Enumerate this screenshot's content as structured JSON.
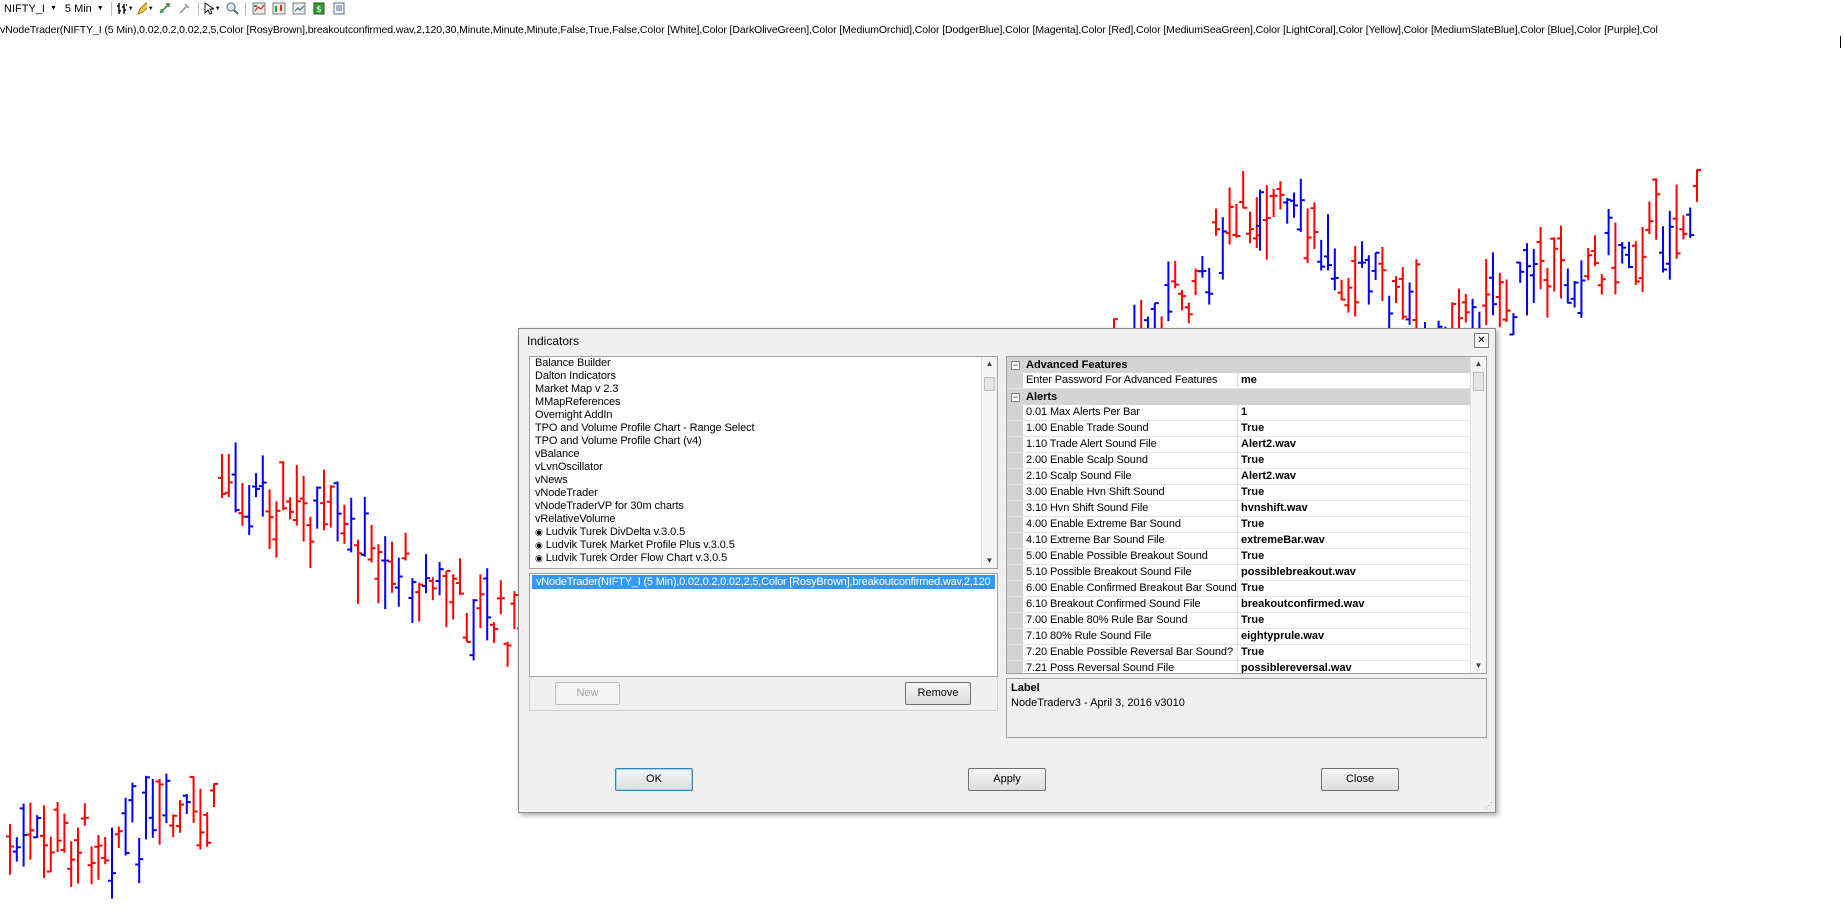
{
  "toolbar": {
    "instrument": "NIFTY_I",
    "interval": "5 Min"
  },
  "indicator_label": "vNodeTrader(NIFTY_I (5 Min),0.02,0.2,0.02,2,5,Color [RosyBrown],breakoutconfirmed.wav,2,120,30,Minute,Minute,Minute,False,True,False,Color [White],Color [DarkOliveGreen],Color [MediumOrchid],Color [DodgerBlue],Color [Magenta],Color [Red],Color [MediumSeaGreen],Color [LightCoral],Color [Yellow],Color [MediumSlateBlue],Color [Blue],Color [Purple],Col",
  "colors": {
    "up_bar": "#0000ff",
    "down_bar": "#ff0000",
    "selection": "#3399ff",
    "category_bg": "#d4d4d4"
  },
  "dialog": {
    "title": "Indicators",
    "indicators": [
      {
        "label": "Balance Builder",
        "icon": ""
      },
      {
        "label": "Dalton Indicators",
        "icon": ""
      },
      {
        "label": "Market Map v 2.3",
        "icon": ""
      },
      {
        "label": "MMapReferences",
        "icon": ""
      },
      {
        "label": "Overnight AddIn",
        "icon": ""
      },
      {
        "label": "TPO and Volume Profile Chart - Range Select",
        "icon": ""
      },
      {
        "label": "TPO and Volume Profile Chart (v4)",
        "icon": ""
      },
      {
        "label": "vBalance",
        "icon": ""
      },
      {
        "label": "vLvnOscillator",
        "icon": ""
      },
      {
        "label": "vNews",
        "icon": ""
      },
      {
        "label": "vNodeTrader",
        "icon": ""
      },
      {
        "label": "vNodeTraderVP for 30m charts",
        "icon": ""
      },
      {
        "label": "vRelativeVolume",
        "icon": ""
      },
      {
        "label": "Ludvik Turek DivDelta v.3.0.5",
        "icon": "eye-icon"
      },
      {
        "label": "Ludvik Turek Market Profile Plus v.3.0.5",
        "icon": "eye-icon"
      },
      {
        "label": "Ludvik Turek Order Flow Chart v.3.0.5",
        "icon": "eye-icon"
      }
    ],
    "applied": "vNodeTrader(NIFTY_I (5 Min),0.02,0.2,0.02,2,5,Color [RosyBrown],breakoutconfirmed.wav,2,120",
    "new_label": "New",
    "remove_label": "Remove",
    "ok_label": "OK",
    "apply_label": "Apply",
    "close_label": "Close",
    "properties": {
      "advanced_title": "Advanced Features",
      "advanced": [
        {
          "name": "Enter Password For Advanced Features",
          "value": "me"
        }
      ],
      "alerts_title": "Alerts",
      "alerts": [
        {
          "name": "0.01 Max Alerts Per Bar",
          "value": "1"
        },
        {
          "name": "1.00 Enable Trade Sound",
          "value": "True"
        },
        {
          "name": "1.10 Trade Alert Sound File",
          "value": "Alert2.wav"
        },
        {
          "name": "2.00 Enable Scalp Sound",
          "value": "True"
        },
        {
          "name": "2.10 Scalp Sound File",
          "value": "Alert2.wav"
        },
        {
          "name": "3.00 Enable Hvn Shift Sound",
          "value": "True"
        },
        {
          "name": "3.10 Hvn Shift Sound File",
          "value": "hvnshift.wav"
        },
        {
          "name": "4.00 Enable Extreme Bar Sound",
          "value": "True"
        },
        {
          "name": "4.10 Extreme Bar Sound File",
          "value": "extremeBar.wav"
        },
        {
          "name": "5.00 Enable Possible Breakout Sound",
          "value": "True"
        },
        {
          "name": "5.10 Possible Breakout Sound File",
          "value": "possiblebreakout.wav"
        },
        {
          "name": "6.00 Enable Confirmed Breakout Bar Sound",
          "value": "True"
        },
        {
          "name": "6.10 Breakout Confirmed Sound File",
          "value": "breakoutconfirmed.wav"
        },
        {
          "name": "7.00 Enable 80% Rule Bar Sound",
          "value": "True"
        },
        {
          "name": "7.10 80% Rule Sound File",
          "value": "eightyprule.wav"
        },
        {
          "name": "7.20 Enable Possible Reversal Bar Sound?",
          "value": "True"
        },
        {
          "name": "7.21 Poss Reversal Sound File",
          "value": "possiblereversal.wav"
        }
      ]
    },
    "description": {
      "title": "Label",
      "text": "NodeTraderv3  - April 3, 2016 v3010"
    }
  }
}
